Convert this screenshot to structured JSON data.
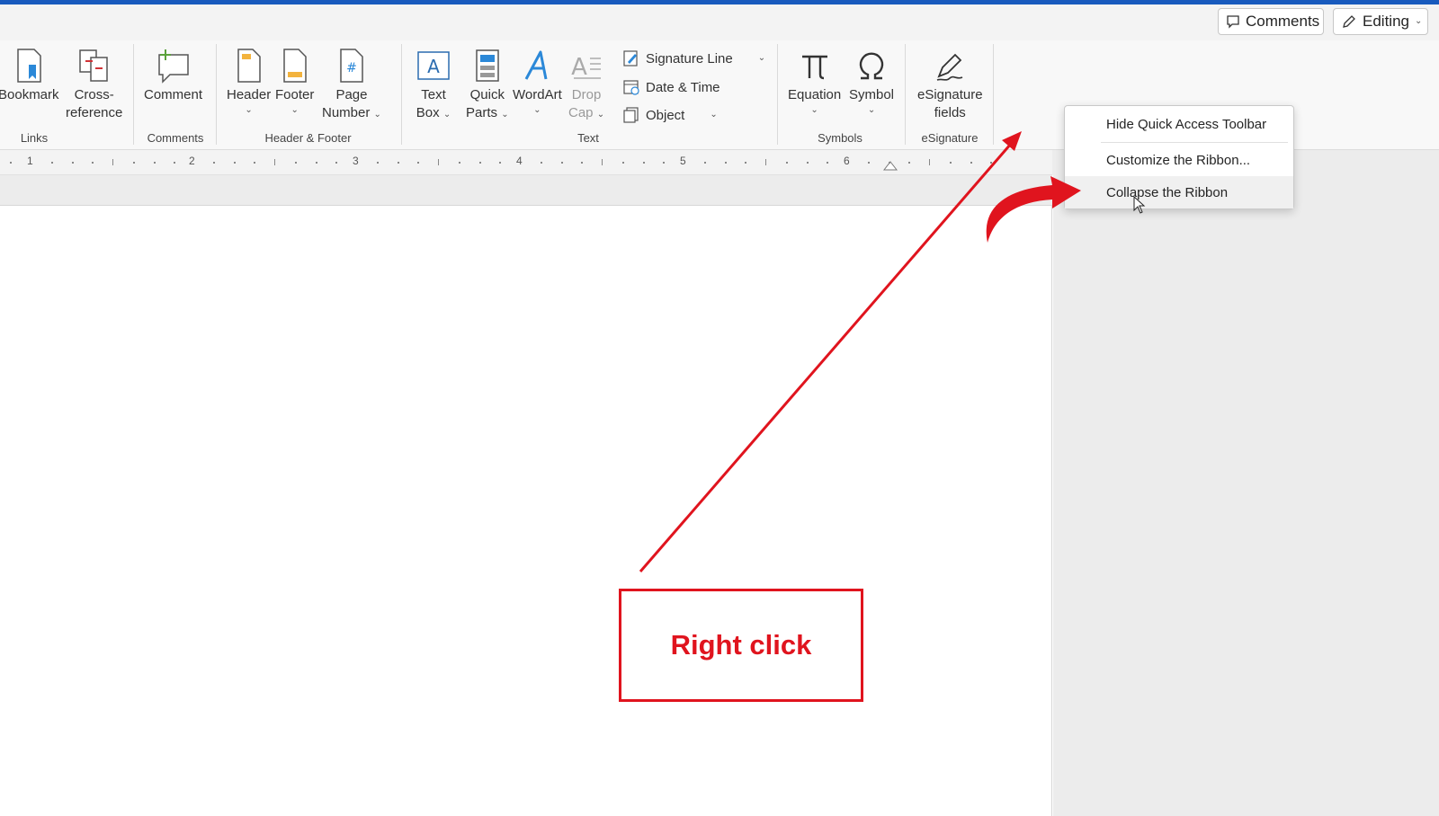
{
  "titlebar": {
    "comments_label": "Comments",
    "editing_label": "Editing"
  },
  "ribbon": {
    "groups": {
      "links": "Links",
      "comments": "Comments",
      "header_footer": "Header & Footer",
      "text": "Text",
      "symbols": "Symbols",
      "esignature": "eSignature"
    },
    "buttons": {
      "bookmark": "Bookmark",
      "cross_reference_1": "Cross-",
      "cross_reference_2": "reference",
      "comment": "Comment",
      "header": "Header",
      "footer": "Footer",
      "page_number_1": "Page",
      "page_number_2": "Number",
      "text_box_1": "Text",
      "text_box_2": "Box",
      "quick_parts_1": "Quick",
      "quick_parts_2": "Parts",
      "wordart": "WordArt",
      "drop_cap_1": "Drop",
      "drop_cap_2": "Cap",
      "signature_line": "Signature Line",
      "date_time": "Date & Time",
      "object": "Object",
      "equation": "Equation",
      "symbol": "Symbol",
      "esignature_fields_1": "eSignature",
      "esignature_fields_2": "fields"
    }
  },
  "ruler": {
    "numbers": [
      "1",
      "2",
      "3",
      "4",
      "5",
      "6"
    ]
  },
  "context_menu": {
    "items": [
      "Hide Quick Access Toolbar",
      "Customize the Ribbon...",
      "Collapse the Ribbon"
    ]
  },
  "annotation": {
    "label": "Right click",
    "color": "#e0141e"
  },
  "colors": {
    "accent": "#185abd",
    "annotation_red": "#e0141e"
  }
}
